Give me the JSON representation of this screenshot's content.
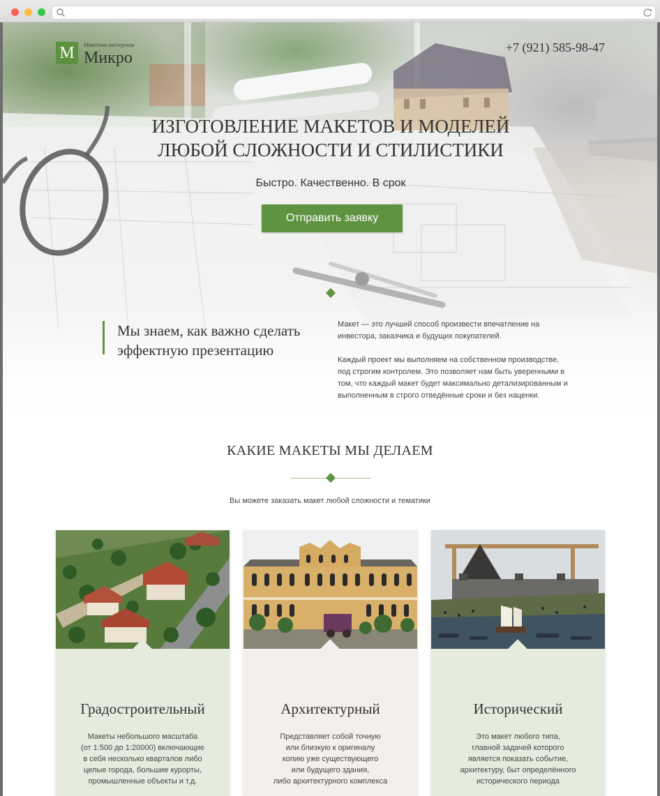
{
  "browser": {
    "url": ""
  },
  "header": {
    "logo_letter": "М",
    "logo_small": "Макетная мастерская",
    "logo_name": "Микро",
    "phone": "+7 (921) 585-98-47"
  },
  "hero": {
    "title_lines": [
      "ИЗГОТОВЛЕНИЕ МАКЕТОВ И МОДЕЛЕЙ",
      "ЛЮБОЙ СЛОЖНОСТИ И СТИЛИСТИКИ"
    ],
    "subtitle": "Быстро. Качественно. В срок",
    "cta_label": "Отправить заявку"
  },
  "intro": {
    "heading_lines": [
      "Мы знаем, как важно сделать",
      "эффектную презентацию"
    ],
    "paragraphs": [
      "Макет — это лучший способ произвести впечатление на инвестора, заказчика и будущих покупателей.",
      "Каждый проект мы выполняем на собственном производстве, под строгим контролем. Это позволяет нам быть уверенными в том, что каждый макет будет максимально детализированным и выполненным в строго отведённые сроки и без наценки."
    ]
  },
  "section": {
    "title": "КАКИЕ МАКЕТЫ МЫ ДЕЛАЕМ",
    "subtitle": "Вы можете заказать макет любой сложности и тематики"
  },
  "cards": [
    {
      "title": "Градостроительный",
      "desc_lines": [
        "Макеты небольшого масштаба",
        "(от 1:500 до 1:20000) включающие",
        "в себя несколько кварталов либо",
        "целые города, большие курорты,",
        "промышленные объекты и т.д."
      ]
    },
    {
      "title": "Архитектурный",
      "desc_lines": [
        "Представляет собой точную",
        "или близкую к оригиналу",
        "копию уже существующего",
        "или будущего здания,",
        "либо архитектурного комплекса"
      ]
    },
    {
      "title": "Исторический",
      "desc_lines": [
        "Это макет любого типа,",
        "главной задачей которого",
        "является показать событие,",
        "архитектуру,  быт определённого",
        "исторического периода"
      ]
    }
  ],
  "colors": {
    "accent": "#5f9342",
    "card_green_bg": "#e5ecdd",
    "card_neutral_bg": "#f2efec"
  }
}
